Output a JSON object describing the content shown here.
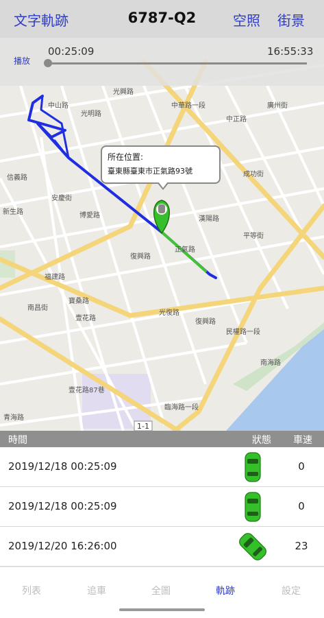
{
  "header": {
    "left_button": "文字軌跡",
    "title": "6787-Q2",
    "right_button_1": "空照",
    "right_button_2": "街景"
  },
  "player": {
    "play_label": "播放",
    "current_time": "00:25:09",
    "end_time": "16:55:33",
    "progress": 0.0
  },
  "map": {
    "streets": [
      "中山路",
      "光明路",
      "中華路一段",
      "中正路",
      "廣州街",
      "光興路",
      "安慶街",
      "信義路",
      "成功街",
      "漢陽路",
      "復興路",
      "博愛路",
      "正氣路",
      "平等街",
      "新生路",
      "福建路",
      "寶桑路",
      "南昌街",
      "光復路",
      "復興路",
      "壹花路",
      "壹花路87巷",
      "臨海路一段",
      "南海路",
      "青海路",
      "民權路一段"
    ],
    "route_label": "1-1"
  },
  "popup": {
    "title": "所在位置:",
    "address": "臺東縣臺東市正氣路93號"
  },
  "table": {
    "headers": {
      "time": "時間",
      "status": "狀態",
      "speed": "車速"
    },
    "rows": [
      {
        "time": "2019/12/18 00:25:09",
        "speed": "0"
      },
      {
        "time": "2019/12/18 00:25:09",
        "speed": "0"
      },
      {
        "time": "2019/12/20 16:26:00",
        "speed": "23"
      }
    ]
  },
  "nav": {
    "tabs": [
      "列表",
      "追車",
      "全圖",
      "軌跡",
      "設定"
    ],
    "active": "軌跡"
  },
  "colors": {
    "accent": "#2f3cc2",
    "track": "#1f2ee0",
    "track_recent": "#44c236",
    "car": "#35c02b"
  }
}
